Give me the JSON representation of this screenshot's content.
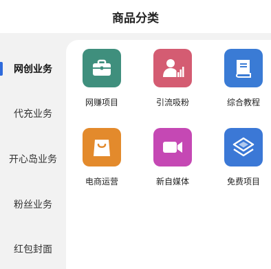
{
  "header": {
    "title": "商品分类"
  },
  "sidebar": {
    "items": [
      {
        "label": "网创业务",
        "active": true
      },
      {
        "label": "代充业务",
        "active": false
      },
      {
        "label": "开心岛业务",
        "active": false
      },
      {
        "label": "粉丝业务",
        "active": false
      },
      {
        "label": "红包封面",
        "active": false
      }
    ]
  },
  "grid": {
    "items": [
      {
        "label": "网赚项目",
        "icon": "briefcase-icon",
        "color": "#3f8f7d"
      },
      {
        "label": "引流吸粉",
        "icon": "user-growth-icon",
        "color": "#d45c72"
      },
      {
        "label": "综合教程",
        "icon": "book-icon",
        "color": "#3a7bd5"
      },
      {
        "label": "电商运营",
        "icon": "shopping-bag-icon",
        "color": "#e38a2c"
      },
      {
        "label": "新自媒体",
        "icon": "video-camera-icon",
        "color": "#c548b4"
      },
      {
        "label": "免费项目",
        "icon": "layers-icon",
        "color": "#3b78d6"
      }
    ]
  },
  "colors": {
    "accent": "#2f6bdc",
    "sidebar_bg": "#f2f2f2"
  }
}
